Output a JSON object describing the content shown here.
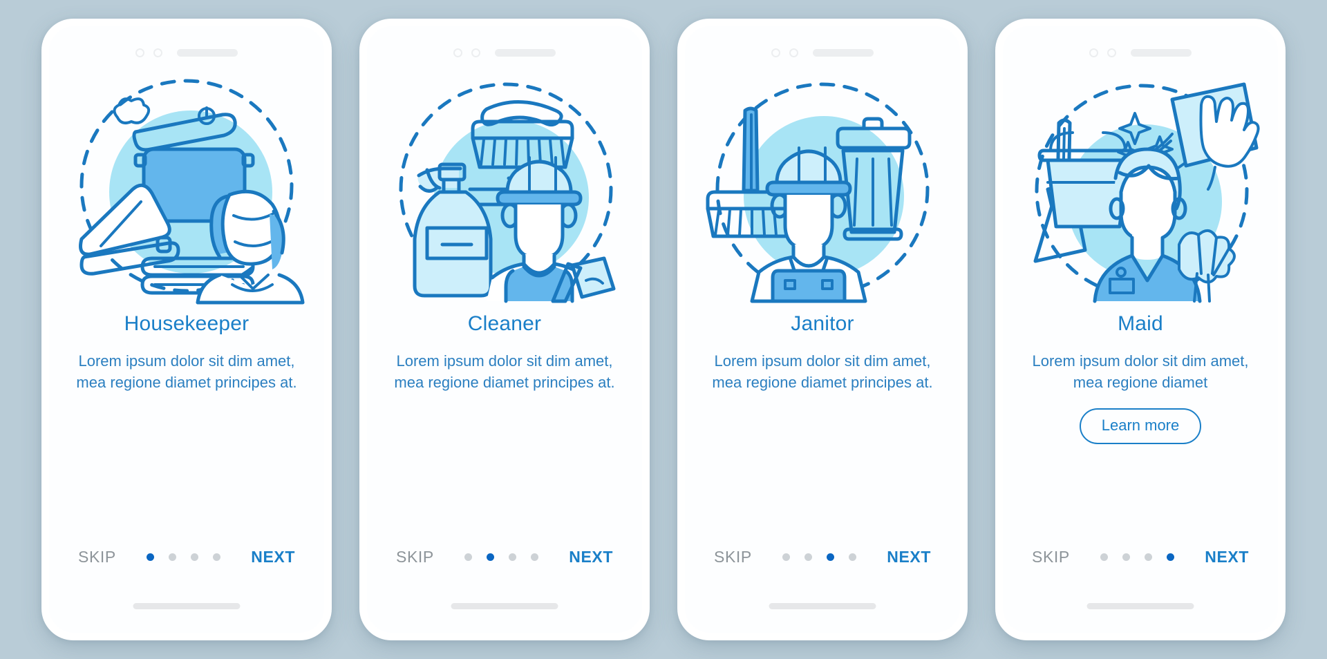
{
  "app": {
    "background_color": "#b9ccd7",
    "accent_color": "#1a7fc8",
    "active_dot_color": "#0a66c2",
    "inactive_dot_color": "#cdd2d6",
    "skip_color": "#8d9499"
  },
  "common": {
    "skip_label": "SKIP",
    "next_label": "NEXT",
    "dot_count": 4
  },
  "screens": [
    {
      "id": "housekeeper",
      "title": "Housekeeper",
      "body": "Lorem ipsum dolor sit dim amet, mea regione diamet principes at.",
      "active_index": 0,
      "has_learn_more": false,
      "learn_more_label": "",
      "illustration_name": "housekeeper-illustration",
      "illustration_items": [
        "steaming-pot",
        "iron",
        "folded-towels",
        "housekeeper-woman"
      ]
    },
    {
      "id": "cleaner",
      "title": "Cleaner",
      "body": "Lorem ipsum dolor sit dim amet, mea regione diamet principes at.",
      "active_index": 1,
      "has_learn_more": false,
      "learn_more_label": "",
      "illustration_name": "cleaner-illustration",
      "illustration_items": [
        "scrub-brush",
        "spray-bottle",
        "cleaner-man",
        "squeegee"
      ]
    },
    {
      "id": "janitor",
      "title": "Janitor",
      "body": "Lorem ipsum dolor sit dim amet, mea regione diamet principes at.",
      "active_index": 2,
      "has_learn_more": false,
      "learn_more_label": "",
      "illustration_name": "janitor-illustration",
      "illustration_items": [
        "push-broom",
        "trash-bin",
        "janitor-man"
      ]
    },
    {
      "id": "maid",
      "title": "Maid",
      "body": "Lorem ipsum dolor sit dim amet, mea regione diamet",
      "active_index": 3,
      "has_learn_more": true,
      "learn_more_label": "Learn more",
      "illustration_name": "maid-illustration",
      "illustration_items": [
        "mop",
        "bucket",
        "sparkles",
        "gloved-hand-cloth",
        "maid-woman",
        "feather-duster"
      ]
    }
  ]
}
